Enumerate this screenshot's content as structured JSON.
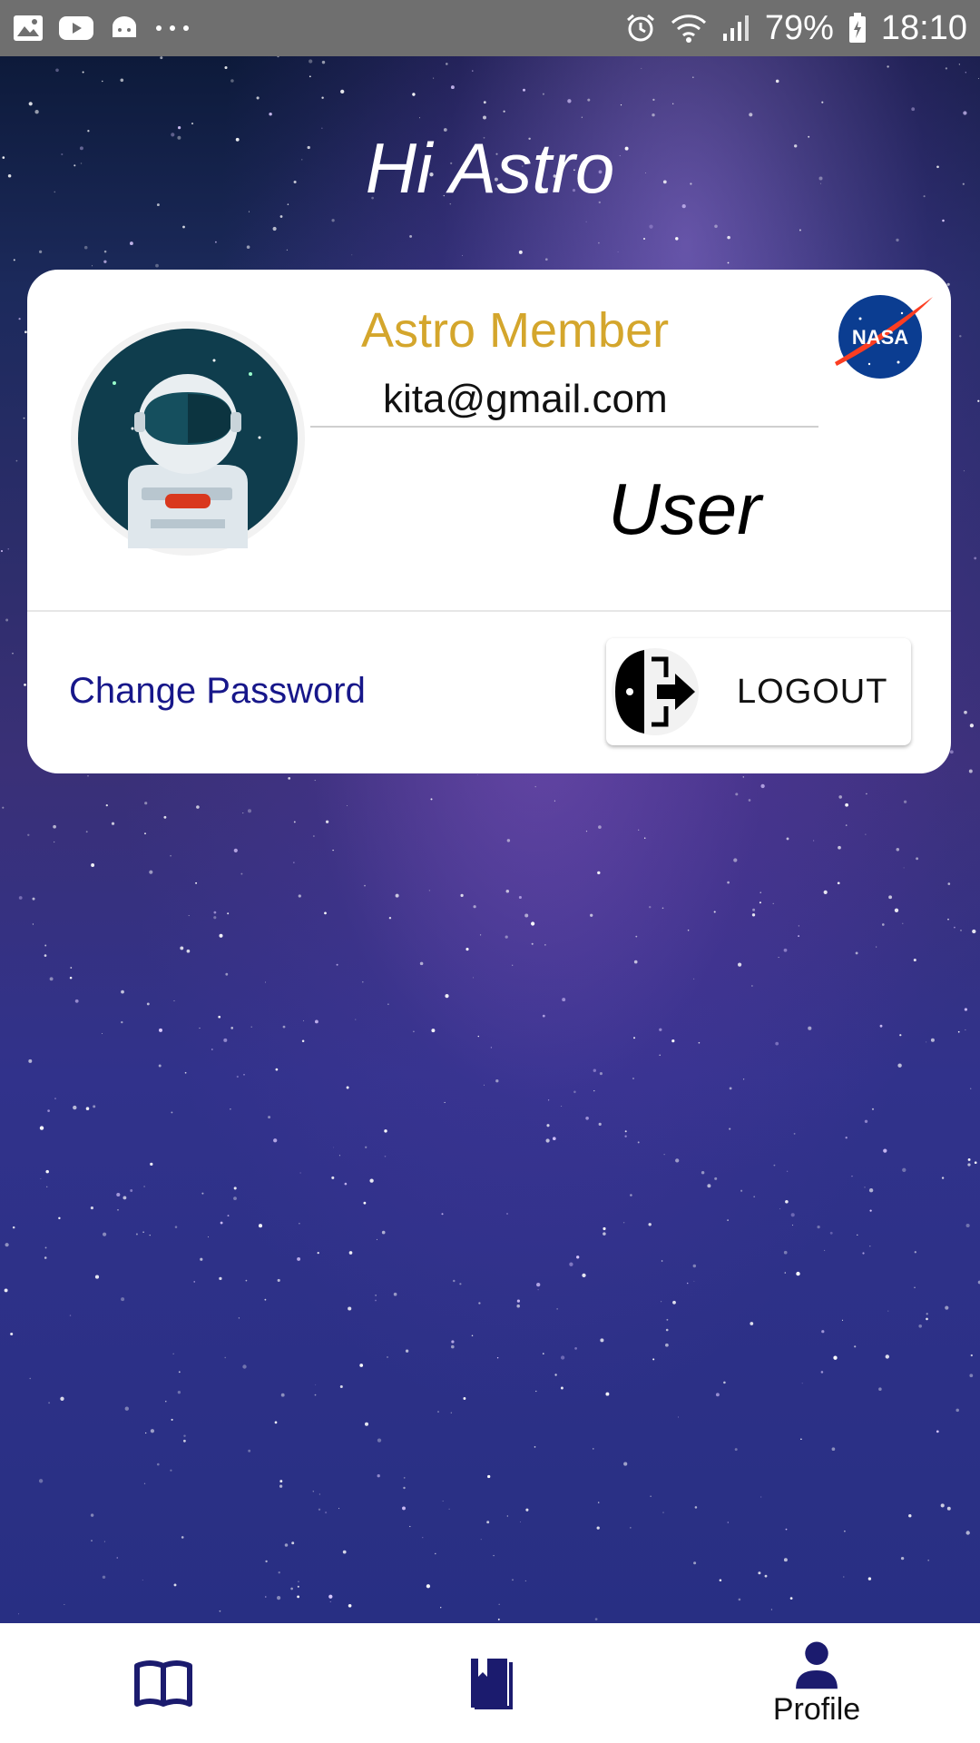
{
  "status_bar": {
    "battery_percent": "79%",
    "time": "18:10",
    "icons": [
      "gallery-icon",
      "youtube-icon",
      "android-icon",
      "more-icon",
      "alarm-icon",
      "wifi-icon",
      "signal-icon",
      "battery-icon"
    ]
  },
  "greeting": "Hi Astro",
  "profile_card": {
    "member_title": "Astro Member",
    "email": "kita@gmail.com",
    "role": "User",
    "change_password_label": "Change Password",
    "logout_label": "LOGOUT",
    "logo_text": "NASA"
  },
  "bottom_nav": {
    "items": [
      {
        "icon": "open-book-icon",
        "label": ""
      },
      {
        "icon": "book-icon",
        "label": ""
      },
      {
        "icon": "person-icon",
        "label": "Profile"
      }
    ]
  },
  "colors": {
    "accent_gold": "#d4a62c",
    "nav_icon": "#1b1b6e",
    "link": "#17178a"
  }
}
